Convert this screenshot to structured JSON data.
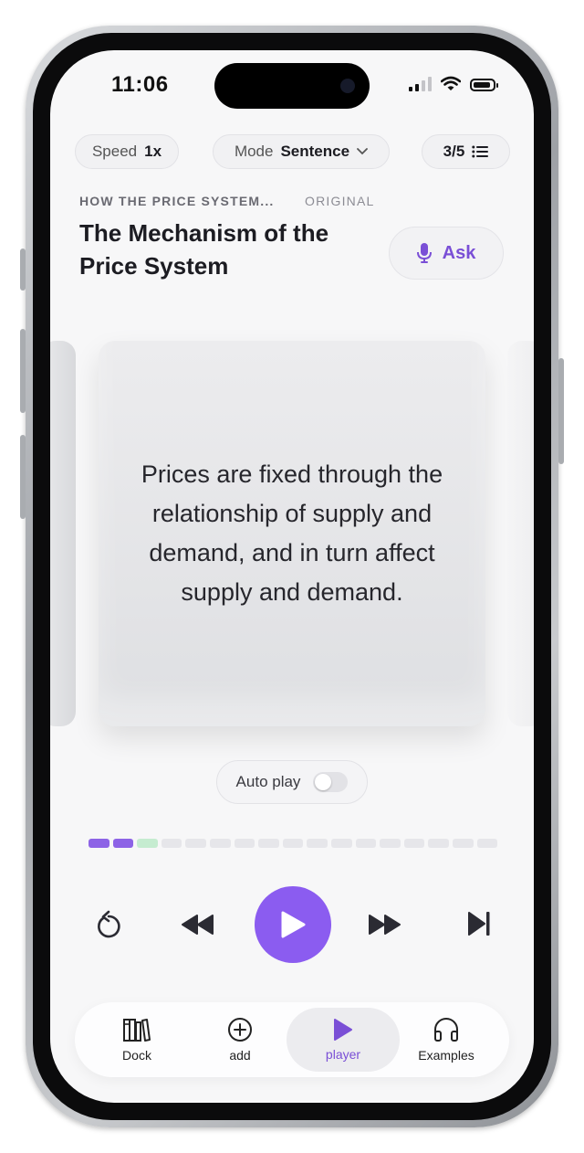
{
  "status_bar": {
    "time": "11:06"
  },
  "controls": {
    "speed_label": "Speed",
    "speed_value": "1x",
    "mode_label": "Mode",
    "mode_value": "Sentence",
    "position": "3/5"
  },
  "header": {
    "breadcrumb": "HOW THE PRICE SYSTEM...",
    "tag": "ORIGINAL",
    "title": "The Mechanism of the Price System",
    "ask_label": "Ask"
  },
  "card": {
    "text": "Prices are fixed through the relationship of supply and demand, and in turn affect supply and demand."
  },
  "autoplay": {
    "label": "Auto play",
    "enabled": false
  },
  "progress": {
    "total_segments": 17,
    "completed": 2,
    "current": 3
  },
  "tabs": [
    {
      "label": "Dock",
      "icon": "books-icon",
      "active": false
    },
    {
      "label": "add",
      "icon": "plus-circle-icon",
      "active": false
    },
    {
      "label": "player",
      "icon": "play-icon",
      "active": true
    },
    {
      "label": "Examples",
      "icon": "headphones-icon",
      "active": false
    }
  ],
  "colors": {
    "accent": "#8b5cf0",
    "accent_text": "#7a4fd6",
    "current_segment": "#c5ecd0"
  }
}
